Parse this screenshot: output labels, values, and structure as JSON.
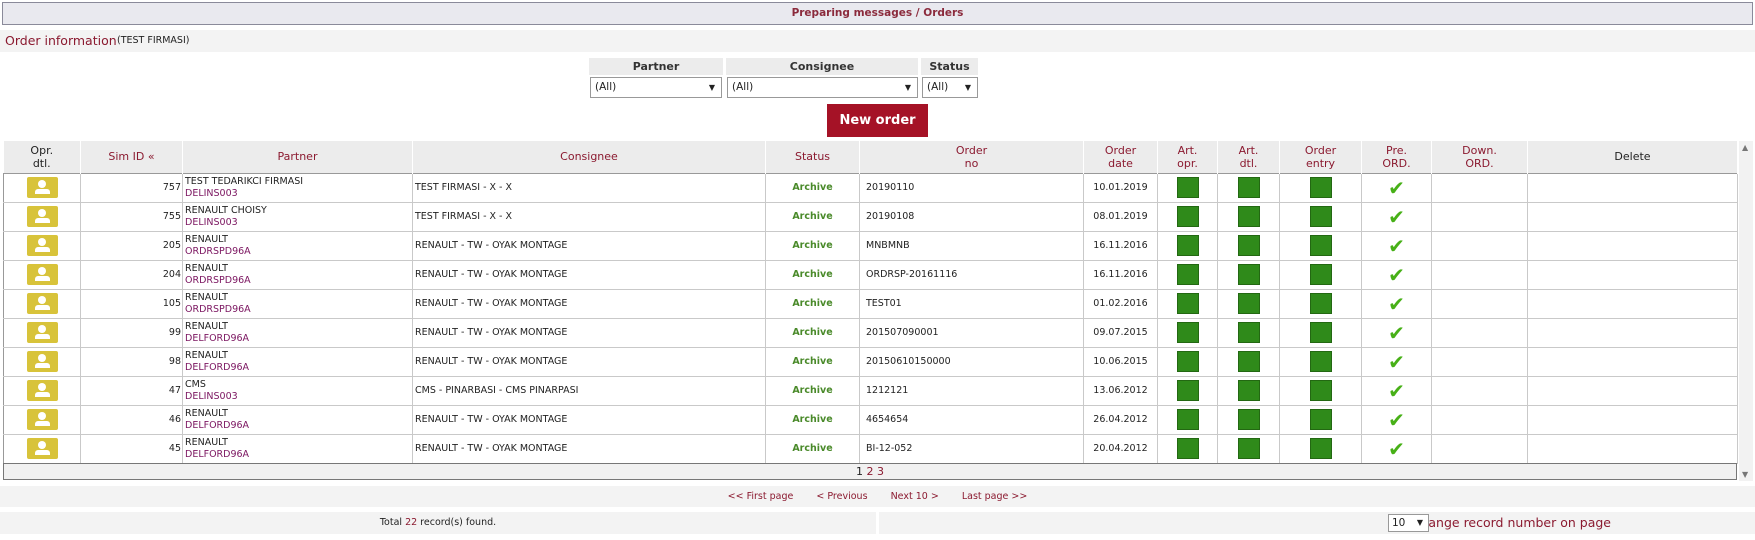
{
  "header": {
    "title": "Preparing messages / Orders"
  },
  "order_info": {
    "title": "Order information",
    "firm": "(TEST FIRMASI)"
  },
  "filters": {
    "partner": {
      "label": "Partner",
      "value": "(All)"
    },
    "consignee": {
      "label": "Consignee",
      "value": "(All)"
    },
    "status": {
      "label": "Status",
      "value": "(All)"
    }
  },
  "new_order_label": "New order",
  "columns": {
    "opr_dtl": "Opr.\ndtl.",
    "sim_id": "Sim ID «",
    "partner": "Partner",
    "consignee": "Consignee",
    "status": "Status",
    "order_no": "Order\nno",
    "order_date": "Order\ndate",
    "art_opr": "Art.\nopr.",
    "art_dtl": "Art.\ndtl.",
    "order_entry": "Order\nentry",
    "pre_ord": "Pre.\nORD.",
    "down_ord": "Down.\nORD.",
    "delete": "Delete"
  },
  "rows": [
    {
      "sim_id": "757",
      "partner": "TEST TEDARIKCI FIRMASI",
      "partner_code": "DELINS003",
      "consignee": "TEST FIRMASI - X - X",
      "status": "Archive",
      "order_no": "20190110",
      "order_date": "10.01.2019",
      "pre_ord": "✔"
    },
    {
      "sim_id": "755",
      "partner": "RENAULT CHOISY",
      "partner_code": "DELINS003",
      "consignee": "TEST FIRMASI - X - X",
      "status": "Archive",
      "order_no": "20190108",
      "order_date": "08.01.2019",
      "pre_ord": "✔"
    },
    {
      "sim_id": "205",
      "partner": "RENAULT",
      "partner_code": "ORDRSPD96A",
      "consignee": "RENAULT - TW - OYAK MONTAGE",
      "status": "Archive",
      "order_no": "MNBMNB",
      "order_date": "16.11.2016",
      "pre_ord": "✔"
    },
    {
      "sim_id": "204",
      "partner": "RENAULT",
      "partner_code": "ORDRSPD96A",
      "consignee": "RENAULT - TW - OYAK MONTAGE",
      "status": "Archive",
      "order_no": "ORDRSP-20161116",
      "order_date": "16.11.2016",
      "pre_ord": "✔"
    },
    {
      "sim_id": "105",
      "partner": "RENAULT",
      "partner_code": "ORDRSPD96A",
      "consignee": "RENAULT - TW - OYAK MONTAGE",
      "status": "Archive",
      "order_no": "TEST01",
      "order_date": "01.02.2016",
      "pre_ord": "✔"
    },
    {
      "sim_id": "99",
      "partner": "RENAULT",
      "partner_code": "DELFORD96A",
      "consignee": "RENAULT - TW - OYAK MONTAGE",
      "status": "Archive",
      "order_no": "201507090001",
      "order_date": "09.07.2015",
      "pre_ord": "✔"
    },
    {
      "sim_id": "98",
      "partner": "RENAULT",
      "partner_code": "DELFORD96A",
      "consignee": "RENAULT - TW - OYAK MONTAGE",
      "status": "Archive",
      "order_no": "20150610150000",
      "order_date": "10.06.2015",
      "pre_ord": "✔"
    },
    {
      "sim_id": "47",
      "partner": "CMS",
      "partner_code": "DELINS003",
      "consignee": "CMS - PINARBASI - CMS PINARPASI",
      "status": "Archive",
      "order_no": "1212121",
      "order_date": "13.06.2012",
      "pre_ord": "✔"
    },
    {
      "sim_id": "46",
      "partner": "RENAULT",
      "partner_code": "DELFORD96A",
      "consignee": "RENAULT - TW - OYAK MONTAGE",
      "status": "Archive",
      "order_no": "4654654",
      "order_date": "26.04.2012",
      "pre_ord": "✔"
    },
    {
      "sim_id": "45",
      "partner": "RENAULT",
      "partner_code": "DELFORD96A",
      "consignee": "RENAULT - TW - OYAK MONTAGE",
      "status": "Archive",
      "order_no": "BI-12-052",
      "order_date": "20.04.2012",
      "pre_ord": "✔"
    }
  ],
  "pages": {
    "p1": "1",
    "p2": "2",
    "p3": "3"
  },
  "nav": {
    "first": "<< First page",
    "prev": "< Previous",
    "next": "Next 10 >",
    "last": "Last page >>"
  },
  "footer": {
    "total_prefix": "Total ",
    "total_count": "22",
    "total_suffix": " record(s) found.",
    "change_label": "Change record number on page",
    "page_size": "10"
  },
  "icons": {
    "operation_detail": "user-detail-icon",
    "article_square": "green-square-icon",
    "pre_order_check": "check-icon"
  },
  "colors": {
    "accent": "#8b1a30",
    "button": "#a51226",
    "green_square": "#2f8a1a",
    "check": "#47b017",
    "status": "#4a8a2a",
    "opr_icon": "#d8c33a"
  }
}
